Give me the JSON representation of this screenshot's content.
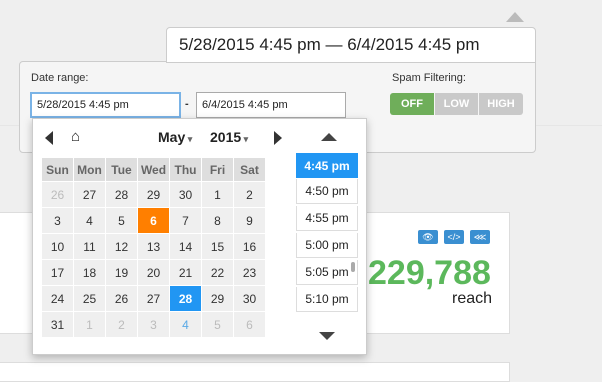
{
  "range_toggle": {
    "text": "5/28/2015 4:45 pm — 6/4/2015 4:45 pm"
  },
  "panel": {
    "date_range_label": "Date range:",
    "start_value": "5/28/2015 4:45 pm",
    "separator": "-",
    "end_value": "6/4/2015 4:45 pm",
    "spam_label": "Spam Filtering:",
    "spam_options": [
      "OFF",
      "LOW",
      "HIGH"
    ],
    "spam_selected": "OFF"
  },
  "calendar": {
    "month": "May",
    "year": "2015",
    "weekdays": [
      "Sun",
      "Mon",
      "Tue",
      "Wed",
      "Thu",
      "Fri",
      "Sat"
    ],
    "weeks": [
      [
        "26",
        "27",
        "28",
        "29",
        "30",
        "1",
        "2"
      ],
      [
        "3",
        "4",
        "5",
        "6",
        "7",
        "8",
        "9"
      ],
      [
        "10",
        "11",
        "12",
        "13",
        "14",
        "15",
        "16"
      ],
      [
        "17",
        "18",
        "19",
        "20",
        "21",
        "22",
        "23"
      ],
      [
        "24",
        "25",
        "26",
        "27",
        "28",
        "29",
        "30"
      ],
      [
        "31",
        "1",
        "2",
        "3",
        "4",
        "5",
        "6"
      ]
    ],
    "today": "6",
    "selected": "28",
    "times": [
      "4:45 pm",
      "4:50 pm",
      "4:55 pm",
      "5:00 pm",
      "5:05 pm",
      "5:10 pm"
    ],
    "selected_time": "4:45 pm"
  },
  "stats": {
    "value": "229,788",
    "caption": "reach",
    "icons": [
      "eye-icon",
      "embed-icon",
      "share-icon"
    ]
  },
  "colors": {
    "accent": "#2196f3",
    "today": "#ff7f00",
    "green": "#5cb85c",
    "off_green": "#6fae5a"
  }
}
